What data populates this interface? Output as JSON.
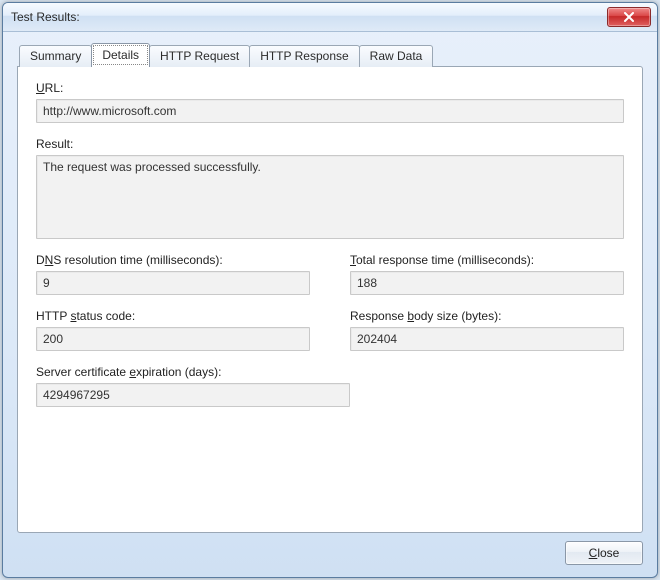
{
  "window": {
    "title": "Test Results:"
  },
  "tabs": {
    "summary": "Summary",
    "details": "Details",
    "http_request": "HTTP Request",
    "http_response": "HTTP Response",
    "raw_data": "Raw Data",
    "active": "details"
  },
  "details": {
    "url_label": "URL:",
    "url_value": "http://www.microsoft.com",
    "result_label": "Result:",
    "result_value": "The request was processed successfully.",
    "dns_label_pre": "D",
    "dns_label_u": "N",
    "dns_label_post": "S resolution time (milliseconds):",
    "dns_value": "9",
    "total_label_u": "T",
    "total_label_post": "otal response time (milliseconds):",
    "total_value": "188",
    "status_label_pre": "HTTP ",
    "status_label_u": "s",
    "status_label_post": "tatus code:",
    "status_value": "200",
    "body_label_pre": "Response ",
    "body_label_u": "b",
    "body_label_post": "ody size (bytes):",
    "body_value": "202404",
    "cert_label_pre": "Server certificate ",
    "cert_label_u": "e",
    "cert_label_post": "xpiration (days):",
    "cert_value": "4294967295"
  },
  "buttons": {
    "close_u": "C",
    "close_post": "lose"
  }
}
